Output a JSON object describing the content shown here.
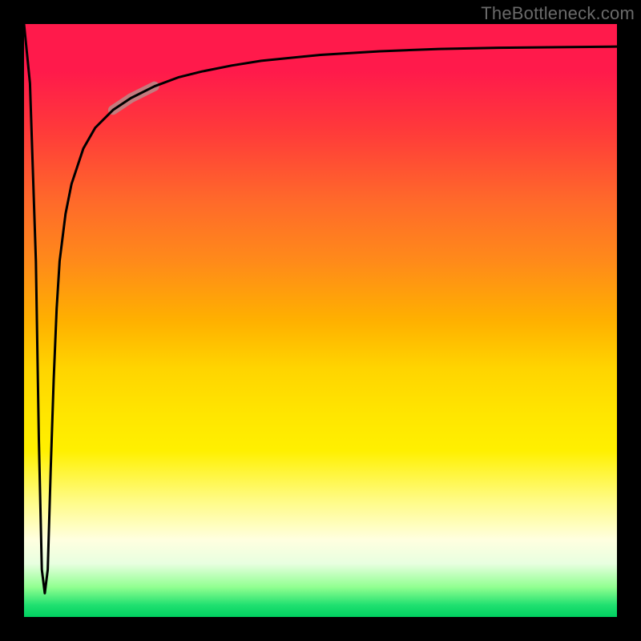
{
  "watermark": "TheBottleneck.com",
  "colors": {
    "frame": "#000000",
    "curve": "#000000",
    "highlight": "#b88a88",
    "gradient_top": "#ff1a4b",
    "gradient_mid": "#ffe600",
    "gradient_bottom": "#00d060"
  },
  "chart_data": {
    "type": "line",
    "title": "",
    "xlabel": "",
    "ylabel": "",
    "xlim": [
      0,
      100
    ],
    "ylim": [
      0,
      100
    ],
    "grid": false,
    "legend": false,
    "annotations": [
      {
        "text": "TheBottleneck.com",
        "pos": "top-right"
      }
    ],
    "series": [
      {
        "name": "curve",
        "x": [
          0.0,
          1.0,
          2.0,
          2.5,
          3.0,
          3.5,
          4.0,
          4.5,
          5.0,
          5.5,
          6.0,
          7.0,
          8.0,
          10.0,
          12.0,
          15.0,
          18.0,
          22.0,
          26.0,
          30.0,
          35.0,
          40.0,
          50.0,
          60.0,
          70.0,
          80.0,
          90.0,
          100.0
        ],
        "y": [
          100.0,
          90.0,
          60.0,
          30.0,
          8.0,
          4.0,
          8.0,
          25.0,
          40.0,
          52.0,
          60.0,
          68.0,
          73.0,
          79.0,
          82.5,
          85.5,
          87.5,
          89.5,
          91.0,
          92.0,
          93.0,
          93.8,
          94.8,
          95.4,
          95.8,
          96.0,
          96.1,
          96.2
        ]
      }
    ],
    "highlight": {
      "series": "curve",
      "x_start": 15.0,
      "x_end": 22.0
    }
  }
}
